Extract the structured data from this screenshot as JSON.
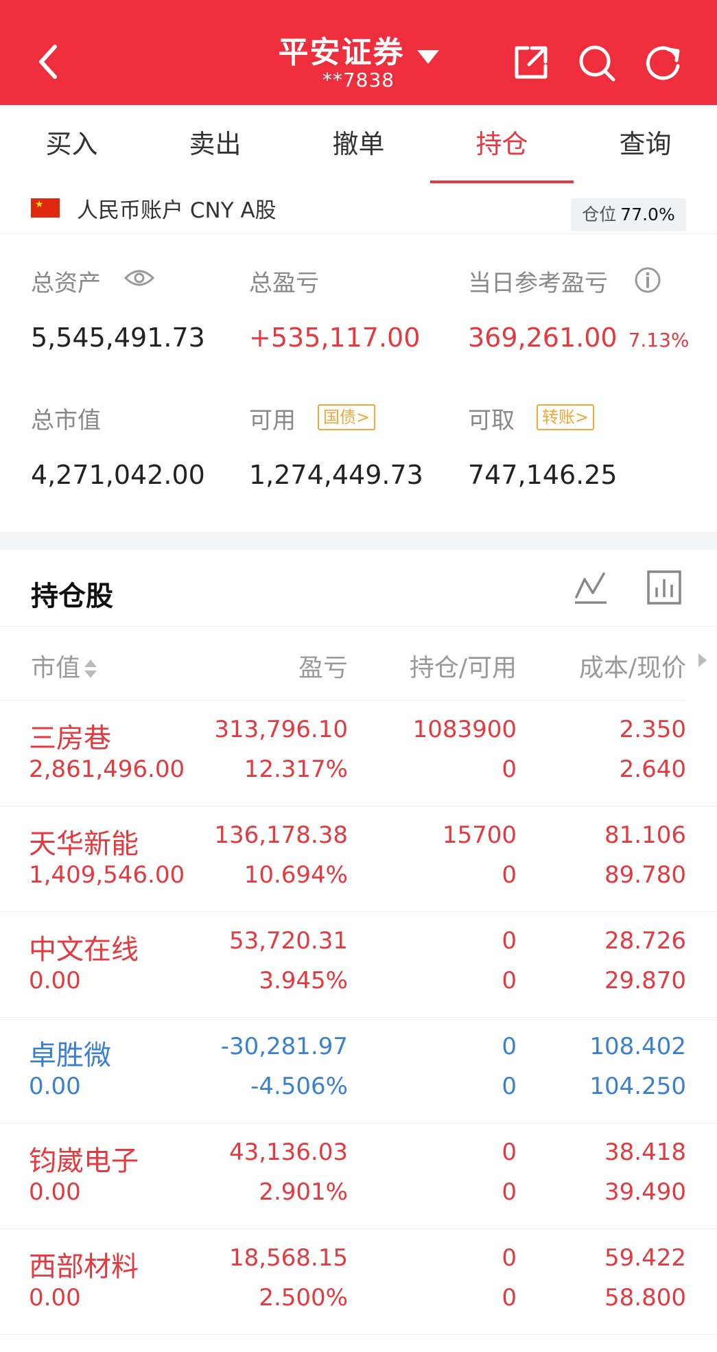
{
  "header": {
    "title": "平安证券",
    "account_no": "**7838"
  },
  "tabs": [
    {
      "label": "买入",
      "active": false
    },
    {
      "label": "卖出",
      "active": false
    },
    {
      "label": "撤单",
      "active": false
    },
    {
      "label": "持仓",
      "active": true
    },
    {
      "label": "查询",
      "active": false
    }
  ],
  "account": {
    "label": "人民币账户 CNY A股",
    "position_label": "仓位",
    "position_value": "77.0%"
  },
  "summary": {
    "total_assets_label": "总资产",
    "total_assets": "5,545,491.73",
    "total_pl_label": "总盈亏",
    "total_pl": "+535,117.00",
    "daily_pl_label": "当日参考盈亏",
    "daily_pl": "369,261.00",
    "daily_pl_pct": "7.13%",
    "market_value_label": "总市值",
    "market_value": "4,271,042.00",
    "available_label": "可用",
    "available": "1,274,449.73",
    "bond_btn": "国债>",
    "withdrawable_label": "可取",
    "withdrawable": "747,146.25",
    "transfer_btn": "转账>"
  },
  "holdings": {
    "title": "持仓股",
    "columns": [
      "市值",
      "盈亏",
      "持仓/可用",
      "成本/现价"
    ],
    "rows": [
      {
        "name": "三房巷",
        "market_value": "2,861,496.00",
        "pl": "313,796.10",
        "pl_pct": "12.317%",
        "qty": "1083900",
        "available": "0",
        "cost": "2.350",
        "price": "2.640",
        "trend": "up"
      },
      {
        "name": "天华新能",
        "market_value": "1,409,546.00",
        "pl": "136,178.38",
        "pl_pct": "10.694%",
        "qty": "15700",
        "available": "0",
        "cost": "81.106",
        "price": "89.780",
        "trend": "up"
      },
      {
        "name": "中文在线",
        "market_value": "0.00",
        "pl": "53,720.31",
        "pl_pct": "3.945%",
        "qty": "0",
        "available": "0",
        "cost": "28.726",
        "price": "29.870",
        "trend": "up"
      },
      {
        "name": "卓胜微",
        "market_value": "0.00",
        "pl": "-30,281.97",
        "pl_pct": "-4.506%",
        "qty": "0",
        "available": "0",
        "cost": "108.402",
        "price": "104.250",
        "trend": "down"
      },
      {
        "name": "钧崴电子",
        "market_value": "0.00",
        "pl": "43,136.03",
        "pl_pct": "2.901%",
        "qty": "0",
        "available": "0",
        "cost": "38.418",
        "price": "39.490",
        "trend": "up"
      },
      {
        "name": "西部材料",
        "market_value": "0.00",
        "pl": "18,568.15",
        "pl_pct": "2.500%",
        "qty": "0",
        "available": "0",
        "cost": "59.422",
        "price": "58.800",
        "trend": "up"
      }
    ]
  },
  "colors": {
    "header_red": "#ee2e3c",
    "up_red": "#e43a3f",
    "down_blue": "#3b7fd0",
    "accent_orange": "#f2a63a"
  }
}
